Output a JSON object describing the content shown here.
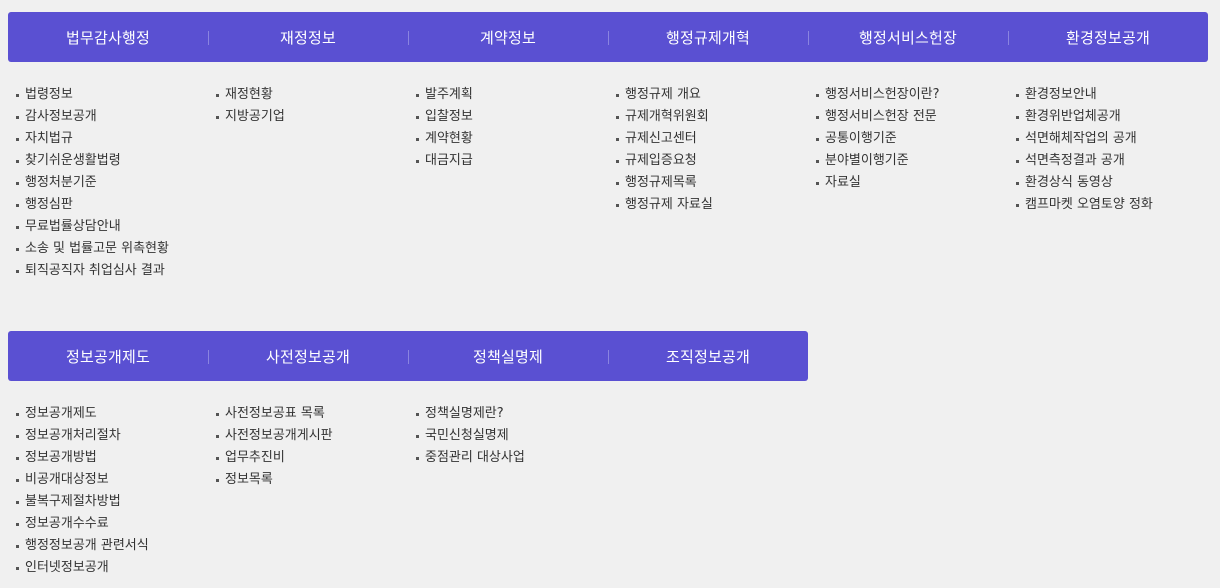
{
  "colors": {
    "bar": "#5a50d2",
    "background": "#f0f0f0",
    "text": "#333333"
  },
  "sections": [
    {
      "tabs": [
        "법무감사행정",
        "재정정보",
        "계약정보",
        "행정규제개혁",
        "행정서비스헌장",
        "환경정보공개"
      ],
      "columns": [
        [
          "법령정보",
          "감사정보공개",
          "자치법규",
          "찾기쉬운생활법령",
          "행정처분기준",
          "행정심판",
          "무료법률상담안내",
          "소송 및 법률고문 위촉현황",
          "퇴직공직자 취업심사 결과"
        ],
        [
          "재정현황",
          "지방공기업"
        ],
        [
          "발주계획",
          "입찰정보",
          "계약현황",
          "대금지급"
        ],
        [
          "행정규제 개요",
          "규제개혁위원회",
          "규제신고센터",
          "규제입증요청",
          "행정규제목록",
          "행정규제 자료실"
        ],
        [
          "행정서비스헌장이란?",
          "행정서비스헌장 전문",
          "공통이행기준",
          "분야별이행기준",
          "자료실"
        ],
        [
          "환경정보안내",
          "환경위반업체공개",
          "석면해체작업의 공개",
          "석면측정결과 공개",
          "환경상식 동영상",
          "캠프마켓 오염토양 정화"
        ]
      ]
    },
    {
      "tabs": [
        "정보공개제도",
        "사전정보공개",
        "정책실명제",
        "조직정보공개"
      ],
      "columns": [
        [
          "정보공개제도",
          "정보공개처리절차",
          "정보공개방법",
          "비공개대상정보",
          "불복구제절차방법",
          "정보공개수수료",
          "행정정보공개 관련서식",
          "인터넷정보공개"
        ],
        [
          "사전정보공표 목록",
          "사전정보공개게시판",
          "업무추진비",
          "정보목록"
        ],
        [
          "정책실명제란?",
          "국민신청실명제",
          "중점관리 대상사업"
        ],
        []
      ]
    }
  ]
}
